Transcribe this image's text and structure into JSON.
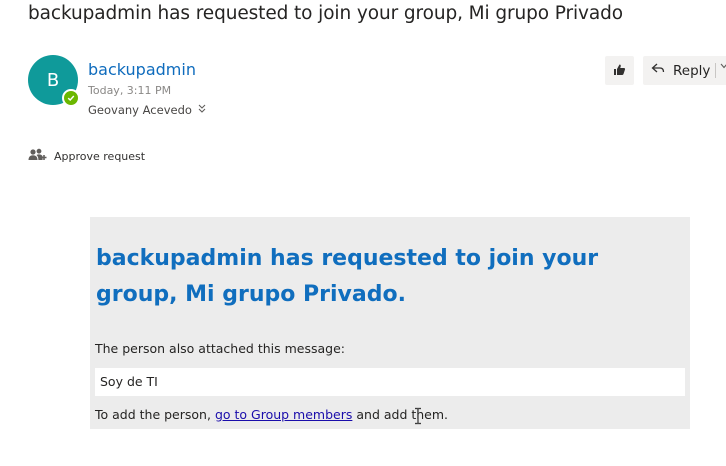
{
  "email": {
    "subject": "backupadmin has requested to join your group, Mi grupo Privado",
    "sender": {
      "initial": "B",
      "name": "backupadmin",
      "time": "Today, 3:11 PM",
      "avatar_color": "#0f9a9a",
      "presence_color": "#6bb700"
    },
    "recipient": "Geovany Acevedo",
    "actions": {
      "react_icon": "thumbs-up-icon",
      "reply_label": "Reply"
    },
    "approve_label": "Approve request"
  },
  "card": {
    "title": "backupadmin has requested to join your group, Mi grupo Privado.",
    "message_label": "The person also attached this message:",
    "message": "Soy de TI",
    "footer_prefix": "To add the person,",
    "footer_link": "go to Group members",
    "footer_suffix": "and add them."
  }
}
